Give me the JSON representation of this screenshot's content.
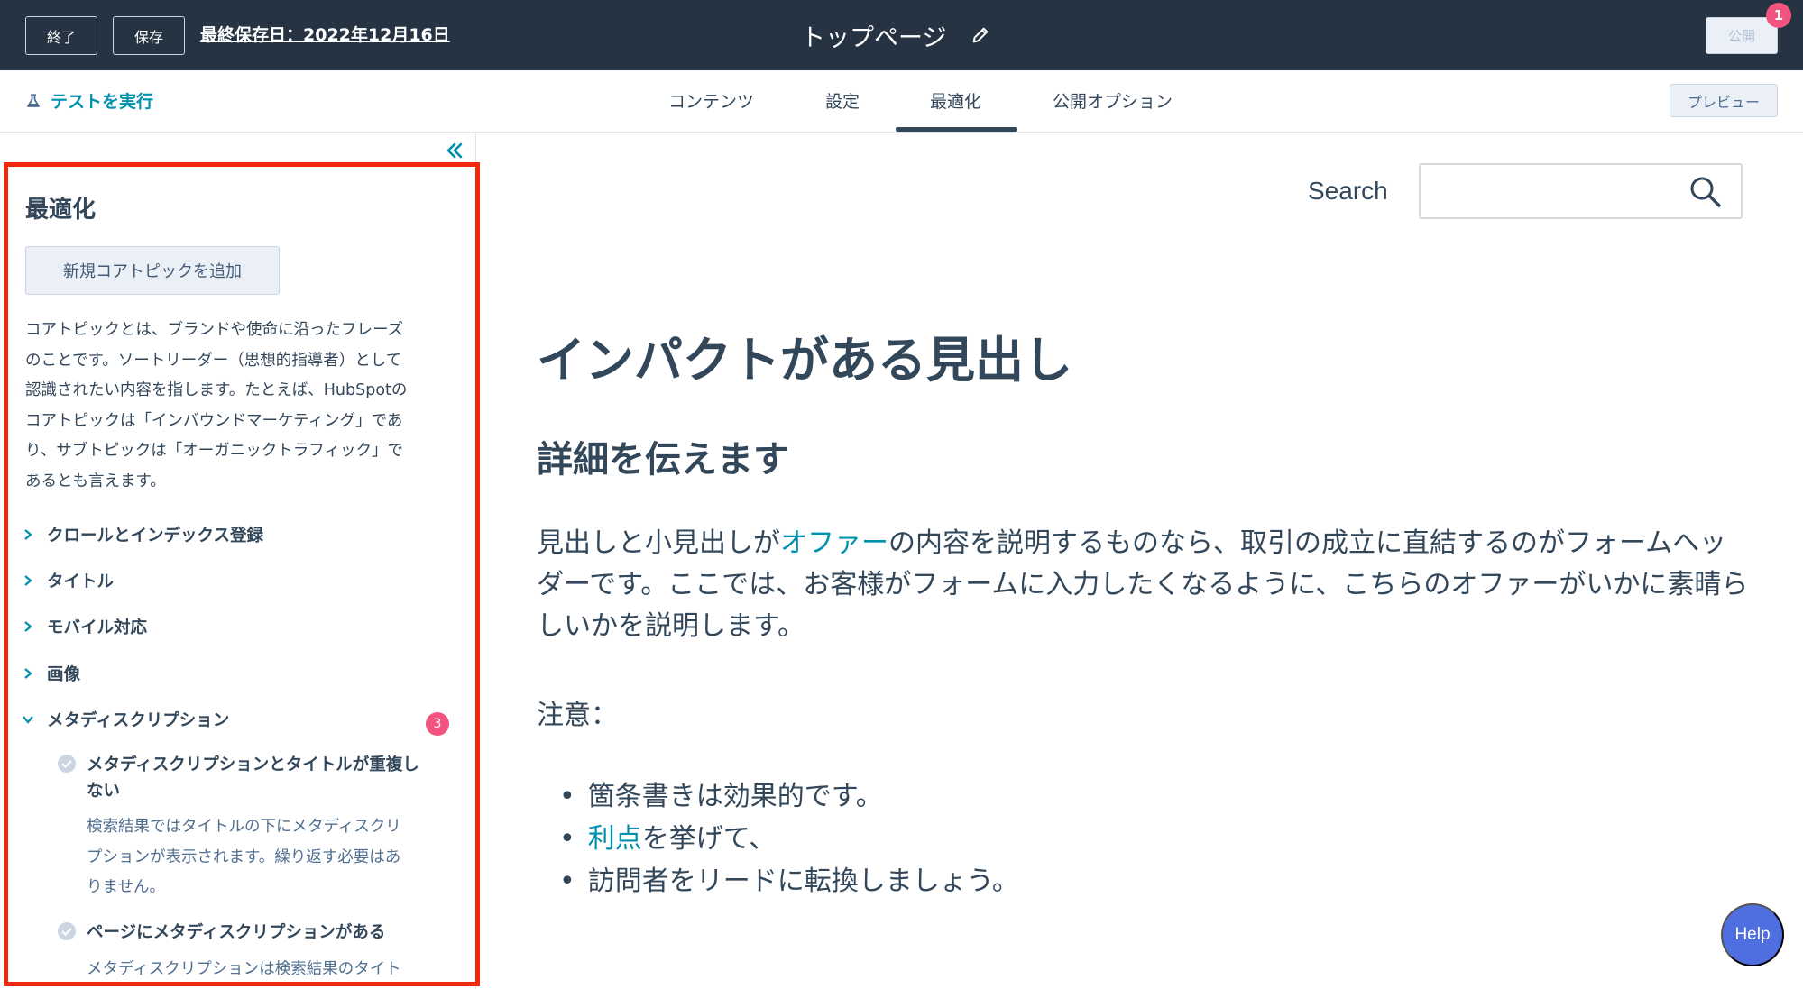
{
  "topbar": {
    "exit_label": "終了",
    "save_label": "保存",
    "last_saved": "最終保存日：2022年12月16日",
    "page_title": "トップページ",
    "publish_label": "公開",
    "publish_badge": "1"
  },
  "navbar": {
    "run_test_label": "テストを実行",
    "tabs": [
      {
        "label": "コンテンツ"
      },
      {
        "label": "設定"
      },
      {
        "label": "最適化"
      },
      {
        "label": "公開オプション"
      }
    ],
    "active_tab": "最適化",
    "preview_label": "プレビュー"
  },
  "sidebar": {
    "title": "最適化",
    "add_topic_label": "新規コアトピックを追加",
    "description_lines": [
      "コアトピックとは、ブランドや使命に沿ったフレーズ",
      "のことです。ソートリーダー（思想的指導者）として",
      "認識されたい内容を指します。たとえば、HubSpotの",
      "コアトピックは「インバウンドマーケティング」であ",
      "り、サブトピックは「オーガニックトラフィック」で",
      "あるとも言えます。"
    ],
    "accordion": [
      {
        "label": "クロールとインデックス登録"
      },
      {
        "label": "タイトル"
      },
      {
        "label": "モバイル対応"
      },
      {
        "label": "画像"
      },
      {
        "label": "メタディスクリプション",
        "badge": "3"
      }
    ],
    "checks": [
      {
        "title_lines": [
          "メタディスクリプションとタイトルが重複し",
          "ない"
        ],
        "desc_lines": [
          "検索結果ではタイトルの下にメタディスクリ",
          "プションが表示されます。繰り返す必要はあ",
          "りません。"
        ]
      },
      {
        "title_lines": [
          "ページにメタディスクリプションがある"
        ],
        "desc_lines": [
          "メタディスクリプションは検索結果のタイト"
        ]
      }
    ]
  },
  "main": {
    "search_label": "Search",
    "h1": "インパクトがある見出し",
    "h2": "詳細を伝えます",
    "para_before_link": "見出しと小見出しが",
    "para_link": "オファー",
    "para_after_link": "の内容を説明するものなら、取引の成立に直結するのがフォームヘッダーです。ここでは、お客様がフォームに入力したくなるように、こちらのオファーがいかに素晴らしいかを説明します。",
    "note": "注意：",
    "bullet_1": "箇条書きは効果的です。",
    "bullet_2_link": "利点",
    "bullet_2_rest": "を挙げて、",
    "bullet_3": "訪問者をリードに転換しましょう。",
    "help_label": "Help"
  },
  "colors": {
    "topbar_bg": "#253342",
    "link": "#0091ae",
    "badge": "#f2547d",
    "highlight_border": "#f2270c",
    "help_bg": "#4f6ee0"
  }
}
